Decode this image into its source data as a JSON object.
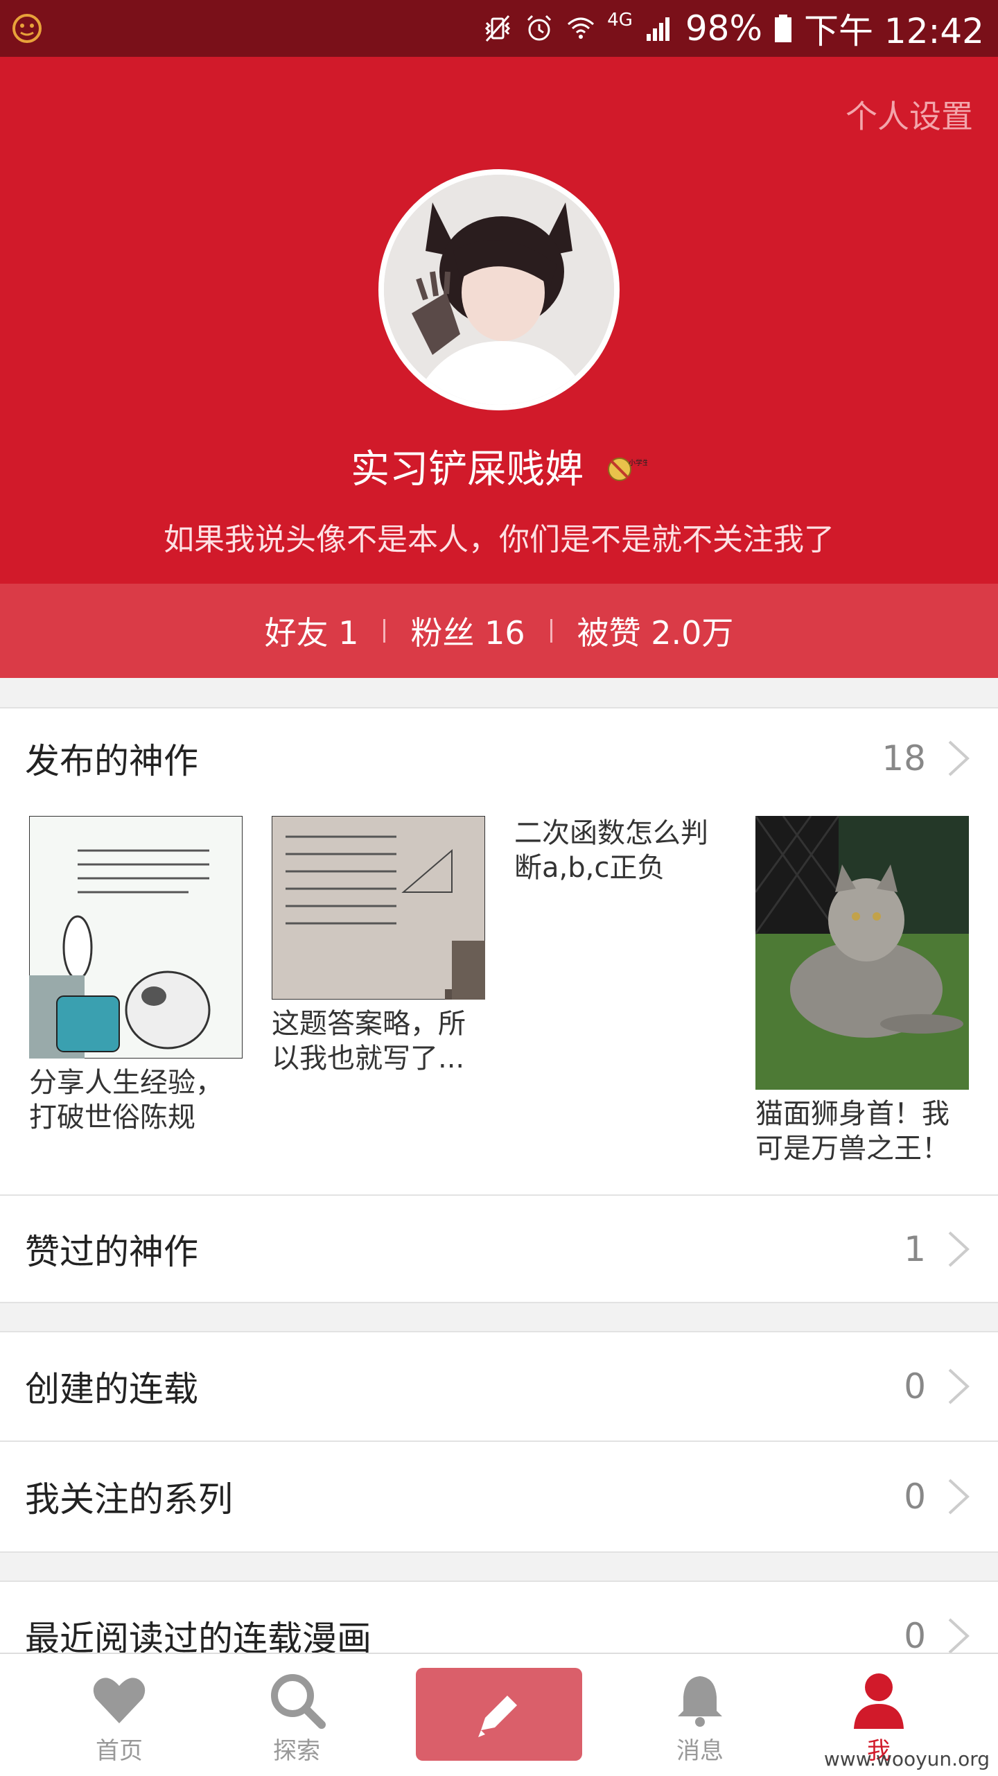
{
  "status_bar": {
    "battery": "98%",
    "network": "4G",
    "time": "下午 12:42"
  },
  "header": {
    "settings_label": "个人设置",
    "username": "实习铲屎贱婢",
    "badge_text": "小学生",
    "bio": "如果我说头像不是本人，你们是不是就不关注我了"
  },
  "stats": {
    "friends": "好友 1",
    "fans": "粉丝 16",
    "likes": "被赞 2.0万"
  },
  "published": {
    "label": "发布的神作",
    "count": "18",
    "items": [
      {
        "caption": "分享人生经验，打破世俗陈规"
      },
      {
        "caption": "这题答案略，所以我也就写了..."
      },
      {
        "caption": "二次函数怎么判断a,b,c正负"
      },
      {
        "caption": "猫面狮身首！我可是万兽之王！"
      }
    ]
  },
  "liked": {
    "label": "赞过的神作",
    "count": "1"
  },
  "created_series": {
    "label": "创建的连载",
    "count": "0"
  },
  "followed_series": {
    "label": "我关注的系列",
    "count": "0"
  },
  "recent_read": {
    "label": "最近阅读过的连载漫画",
    "count": "0"
  },
  "nav": {
    "home": "首页",
    "explore": "探索",
    "messages": "消息",
    "me": "我"
  },
  "colors": {
    "brand_red": "#d11a2a",
    "stats_red": "#da3b47",
    "compose_button": "#da5f6a"
  },
  "watermark": "www.wooyun.org"
}
